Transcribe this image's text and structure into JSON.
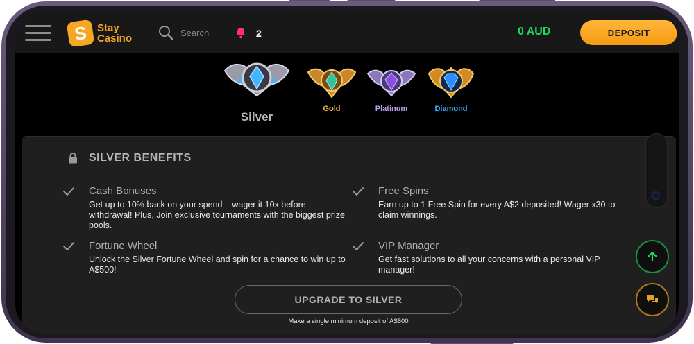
{
  "header": {
    "brand_line1": "Stay",
    "brand_line2": "Casino",
    "brand_mark": "S",
    "search_label": "Search",
    "notification_count": "2",
    "balance": "0 AUD",
    "deposit_label": "DEPOSIT"
  },
  "tiers": [
    {
      "label": "Silver",
      "color": "#b8b8b8",
      "selected": true
    },
    {
      "label": "Gold",
      "color": "#f5b642"
    },
    {
      "label": "Platinum",
      "color": "#b79cf0"
    },
    {
      "label": "Diamond",
      "color": "#3fb6ff"
    }
  ],
  "benefits_panel": {
    "title": "SILVER BENEFITS",
    "items": [
      {
        "title": "Cash Bonuses",
        "description": "Get up to 10% back on your spend – wager it 10x before withdrawal! Plus, Join exclusive tournaments with the biggest prize pools."
      },
      {
        "title": "Free Spins",
        "description": "Earn up to 1 Free Spin for every A$2 deposited! Wager x30 to claim winnings."
      },
      {
        "title": "Fortune Wheel",
        "description": "Unlock the Silver Fortune Wheel and spin for a chance to win up to A$500!"
      },
      {
        "title": "VIP Manager",
        "description": "Get fast solutions to all your concerns with a personal VIP manager!"
      }
    ],
    "upgrade_label": "UPGRADE TO SILVER",
    "upgrade_note": "Make a single minimum deposit of A$500"
  },
  "colors": {
    "accent": "#f5a623",
    "balance": "#1ed760",
    "notification": "#ff2d7a",
    "scroll_top": "#1e8f3a",
    "chat": "#e5a020"
  },
  "icons": [
    "menu-icon",
    "search-icon",
    "bell-icon",
    "lock-icon",
    "check-icon",
    "arrow-up-icon",
    "chat-icon"
  ]
}
